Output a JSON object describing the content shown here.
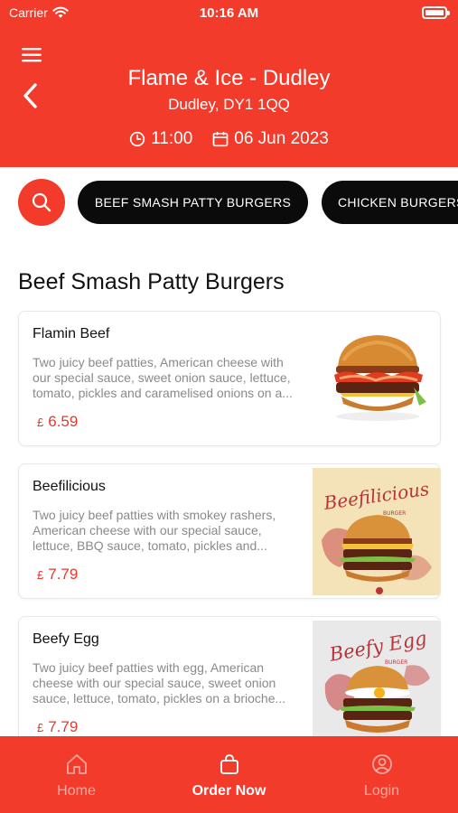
{
  "status_bar": {
    "carrier": "Carrier",
    "time": "10:16 AM"
  },
  "restaurant": {
    "name": "Flame & Ice - Dudley",
    "address": "Dudley, DY1 1QQ",
    "time": "11:00",
    "date": "06 Jun 2023"
  },
  "categories": [
    {
      "label": "BEEF SMASH PATTY BURGERS",
      "active": true
    },
    {
      "label": "CHICKEN BURGERS",
      "active": false
    }
  ],
  "section_title": "Beef Smash Patty Burgers",
  "items": [
    {
      "name": "Flamin Beef",
      "description": "Two juicy beef patties, American cheese with our special sauce, sweet onion sauce, lettuce, tomato, pickles and caramelised onions on a...",
      "currency": "£",
      "price": "6.59"
    },
    {
      "name": "Beefilicious",
      "description": "Two juicy beef patties with smokey rashers, American cheese with our special sauce, lettuce, BBQ sauce, tomato, pickles and...",
      "currency": "£",
      "price": "7.79",
      "image_text": "Beefilicious",
      "image_subtext": "BURGER"
    },
    {
      "name": "Beefy Egg",
      "description": "Two juicy beef patties with egg, American cheese with our special sauce, sweet onion sauce, lettuce, tomato, pickles on a brioche...",
      "currency": "£",
      "price": "7.79",
      "image_text": "Beefy Egg",
      "image_subtext": "BURGER"
    }
  ],
  "nav": {
    "home": "Home",
    "order_now": "Order Now",
    "login": "Login"
  },
  "colors": {
    "brand": "#f23b2a",
    "pill": "#0b0b0b",
    "price": "#e7382a"
  }
}
